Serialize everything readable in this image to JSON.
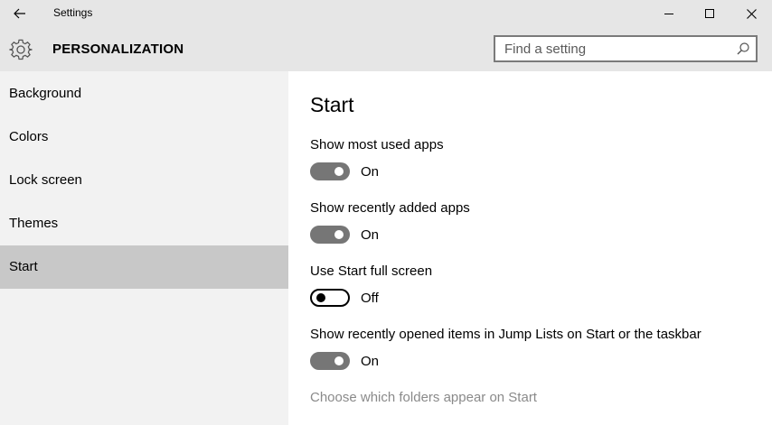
{
  "window": {
    "title": "Settings"
  },
  "header": {
    "title": "PERSONALIZATION",
    "search_placeholder": "Find a setting"
  },
  "sidebar": {
    "items": [
      {
        "label": "Background"
      },
      {
        "label": "Colors"
      },
      {
        "label": "Lock screen"
      },
      {
        "label": "Themes"
      },
      {
        "label": "Start"
      }
    ],
    "selected": "Start"
  },
  "content": {
    "title": "Start",
    "settings": [
      {
        "label": "Show most used apps",
        "state": "On",
        "enabled": true
      },
      {
        "label": "Show recently added apps",
        "state": "On",
        "enabled": true
      },
      {
        "label": "Use Start full screen",
        "state": "Off",
        "enabled": false
      },
      {
        "label": "Show recently opened items in Jump Lists on Start or the taskbar",
        "state": "On",
        "enabled": true
      }
    ],
    "link": "Choose which folders appear on Start"
  },
  "colors": {
    "chrome": "#e6e6e6",
    "sidebar": "#f2f2f2",
    "selected": "#c8c8c8",
    "toggle_on": "#767676",
    "link": "#8a8a8a"
  }
}
